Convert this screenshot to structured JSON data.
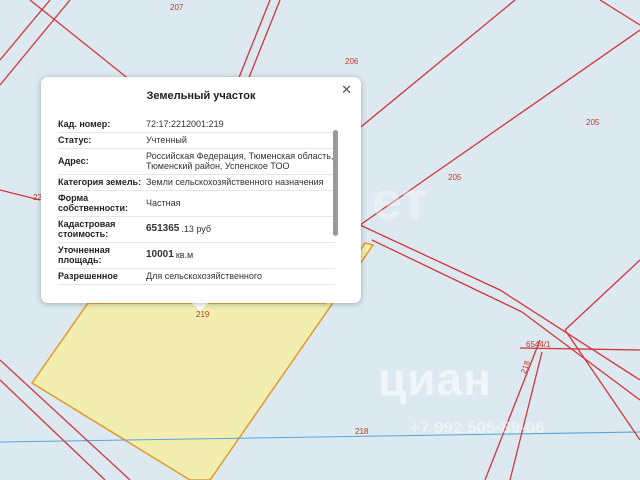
{
  "map": {
    "parcel_labels": [
      {
        "id": "207",
        "text": "207"
      },
      {
        "id": "206",
        "text": "206"
      },
      {
        "id": "205a",
        "text": "205"
      },
      {
        "id": "205b",
        "text": "205"
      },
      {
        "id": "219",
        "text": "219"
      },
      {
        "id": "218a",
        "text": "218"
      },
      {
        "id": "218b",
        "text": "218"
      },
      {
        "id": "6544",
        "text": "6544/1"
      },
      {
        "id": "22",
        "text": "22"
      }
    ],
    "colors": {
      "background": "#dce9f0",
      "boundary": "#d2363a",
      "selected_fill": "#f1eeb0",
      "selected_border": "#e59a2a",
      "road": "#5aa5d8"
    },
    "watermark": "циан",
    "watermark_phone": "+7 992 505-89-06",
    "watermark_top": "ет"
  },
  "popup": {
    "title": "Земельный участок",
    "close_icon": "close-icon",
    "rows": [
      {
        "label": "Кад. номер:",
        "value": "72:17:2212001:219"
      },
      {
        "label": "Статус:",
        "value": "Учтенный"
      },
      {
        "label": "Адрес:",
        "value": "Российская Федерация, Тюменская область, Тюменский район, Успенское ТОО"
      },
      {
        "label": "Категория земель:",
        "value": "Земли сельскохозяйственного назначения"
      },
      {
        "label": "Форма собственности:",
        "value": "Частная"
      },
      {
        "label": "Кадастровая стоимость:",
        "value_main": "651365",
        "value_rest": ".13 руб"
      },
      {
        "label": "Уточненная площадь:",
        "value_main": "10001",
        "value_rest": "кв.м"
      },
      {
        "label": "Разрешенное",
        "value": "Для сельскохозяйственного"
      }
    ]
  }
}
